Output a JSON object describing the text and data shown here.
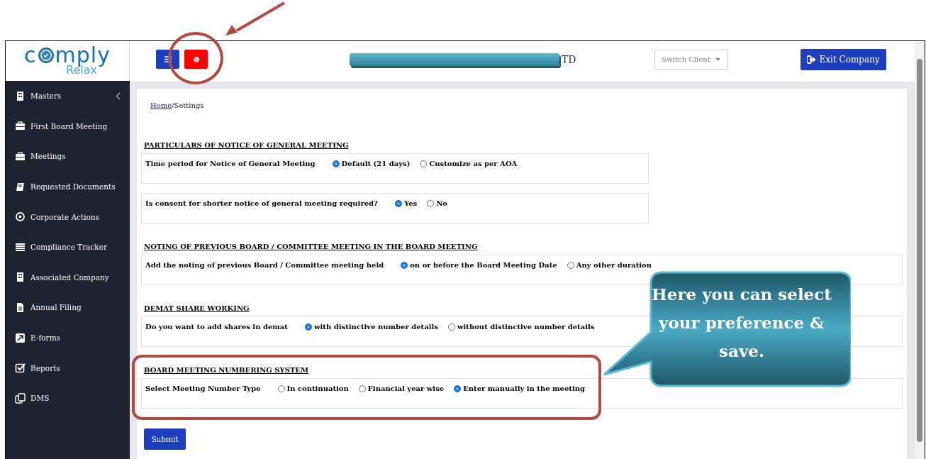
{
  "sidebar": {
    "logo": {
      "word_start": "c",
      "word_end": "mply",
      "tagline": "Relax"
    },
    "items": [
      {
        "label": "Masters",
        "has_submenu": true
      },
      {
        "label": "First Board Meeting",
        "has_submenu": false
      },
      {
        "label": "Meetings",
        "has_submenu": false
      },
      {
        "label": "Requested Documents",
        "has_submenu": false
      },
      {
        "label": "Corporate Actions",
        "has_submenu": false
      },
      {
        "label": "Compliance Tracker",
        "has_submenu": false
      },
      {
        "label": "Associated Company",
        "has_submenu": false
      },
      {
        "label": "Annual Filing",
        "has_submenu": false
      },
      {
        "label": "E-forms",
        "has_submenu": false
      },
      {
        "label": "Reports",
        "has_submenu": false
      },
      {
        "label": "DMS",
        "has_submenu": false
      }
    ]
  },
  "header": {
    "company_name": "TD",
    "switch_client": "Switch Client",
    "exit_button": "Exit Company"
  },
  "breadcrumb": {
    "link": "Home",
    "current": "/Settings"
  },
  "sections": [
    {
      "title": "PARTICULARS OF NOTICE OF GENERAL MEETING",
      "rows": [
        {
          "label": "Time period for Notice of General Meeting",
          "options": [
            {
              "label": "Default (21 days)",
              "selected": true
            },
            {
              "label": "Customize as per AOA",
              "selected": false
            }
          ]
        },
        {
          "label": "Is consent for shorter notice of general meeting required?",
          "options": [
            {
              "label": "Yes",
              "selected": true
            },
            {
              "label": "No",
              "selected": false
            }
          ]
        }
      ]
    },
    {
      "title": "NOTING OF PREVIOUS BOARD / COMMITTEE MEETING IN THE BOARD MEETING",
      "rows": [
        {
          "label": "Add the noting of previous Board / Committee meeting held",
          "options": [
            {
              "label": "on or before the Board Meeting Date",
              "selected": true
            },
            {
              "label": "Any other duration",
              "selected": false
            }
          ]
        }
      ]
    },
    {
      "title": "DEMAT SHARE WORKING",
      "rows": [
        {
          "label": "Do you want to add shares in demat",
          "options": [
            {
              "label": "with distinctive number details",
              "selected": true
            },
            {
              "label": "without distinctive number details",
              "selected": false
            }
          ]
        }
      ]
    },
    {
      "title": "BOARD MEETING NUMBERING SYSTEM",
      "rows": [
        {
          "label": "Select Meeting Number Type",
          "options": [
            {
              "label": "In continuation",
              "selected": false
            },
            {
              "label": "Financial year wise",
              "selected": false
            },
            {
              "label": "Enter manually in the meeting",
              "selected": true
            }
          ]
        }
      ]
    }
  ],
  "submit": "Submit",
  "callout": {
    "text": "Here you can select your preference & save."
  }
}
